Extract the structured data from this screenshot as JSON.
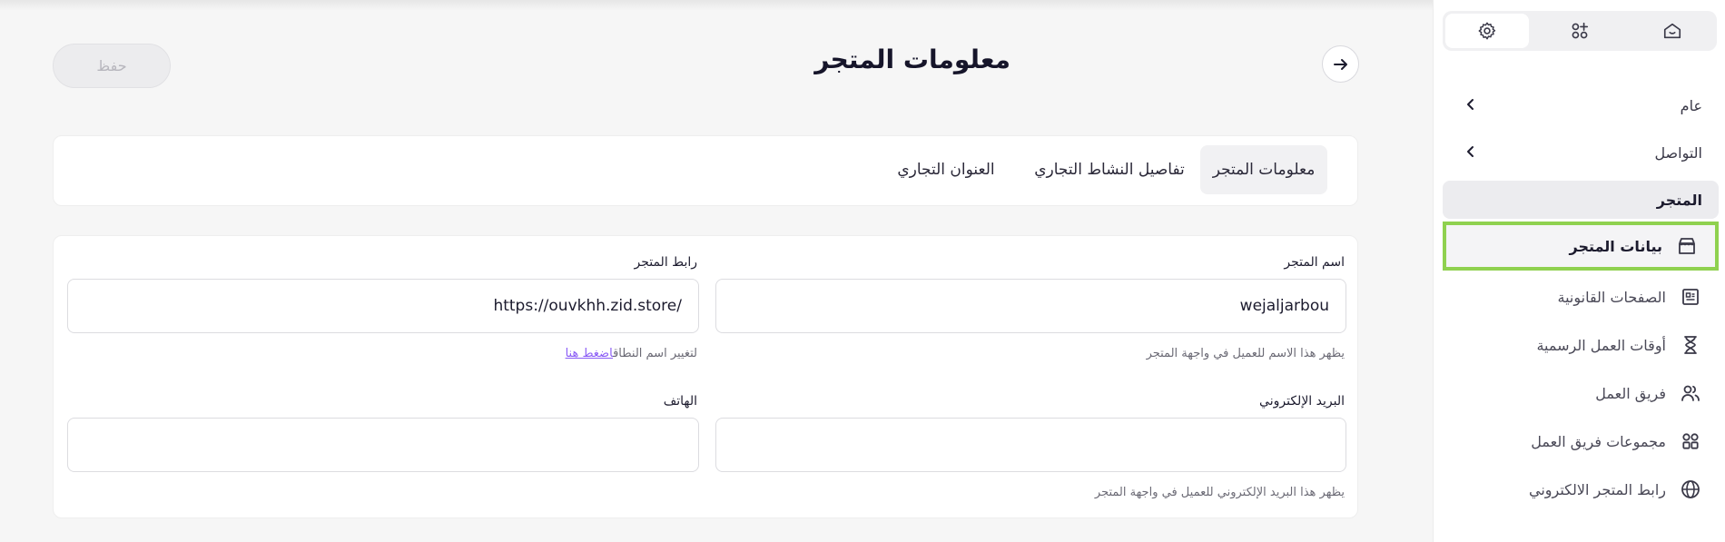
{
  "header": {
    "title": "معلومات المتجر",
    "save_label": "حفظ"
  },
  "tabs": [
    {
      "label": "معلومات المتجر",
      "active": true
    },
    {
      "label": "تفاصيل النشاط التجاري",
      "active": false
    },
    {
      "label": "العنوان التجاري",
      "active": false
    }
  ],
  "form": {
    "store_name": {
      "label": "اسم المتجر",
      "value": "wejaljarbou",
      "hint": "يظهر هذا الاسم للعميل في واجهة المتجر"
    },
    "store_link": {
      "label": "رابط المتجر",
      "value": "https://ouvkhh.zid.store/",
      "hint_text": "لتغيير اسم النطاق",
      "hint_link": "اضغط هنا"
    },
    "email": {
      "label": "البريد الإلكتروني",
      "value": "",
      "hint": "يظهر هذا البريد الإلكتروني للعميل في واجهة المتجر"
    },
    "phone": {
      "label": "الهاتف",
      "value": ""
    }
  },
  "sidebar": {
    "toggle_icons": [
      "home-icon",
      "apps-add-icon",
      "settings-gear-icon"
    ],
    "groups": [
      {
        "label": "عام"
      },
      {
        "label": "التواصل"
      }
    ],
    "section_label": "المتجر",
    "items": [
      {
        "label": "بيانات المتجر",
        "icon": "store-icon",
        "selected": true
      },
      {
        "label": "الصفحات القانونية",
        "icon": "document-icon"
      },
      {
        "label": "أوقات العمل الرسمية",
        "icon": "hourglass-icon"
      },
      {
        "label": "فريق العمل",
        "icon": "users-icon"
      },
      {
        "label": "مجموعات فريق العمل",
        "icon": "groups-icon"
      },
      {
        "label": "رابط المتجر الالكتروني",
        "icon": "globe-icon"
      }
    ],
    "highlight_color": "#8fd14f"
  }
}
